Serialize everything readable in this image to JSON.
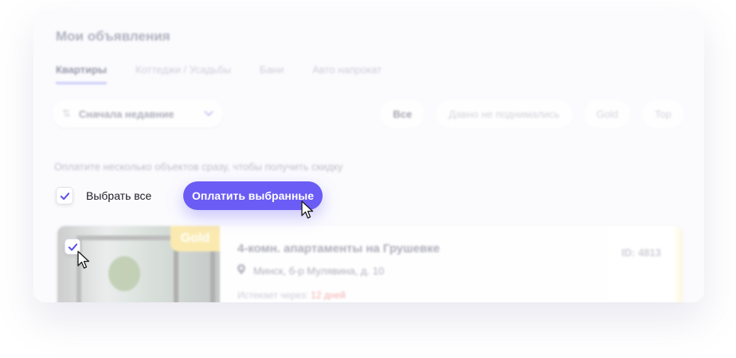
{
  "page": {
    "title": "Мои объявления"
  },
  "tabs": [
    {
      "label": "Квартиры",
      "active": true
    },
    {
      "label": "Коттеджи / Усадьбы",
      "active": false
    },
    {
      "label": "Бани",
      "active": false
    },
    {
      "label": "Авто напрокат",
      "active": false
    }
  ],
  "sort": {
    "label": "Сначала недавние",
    "icon": "sort-icon"
  },
  "filters": [
    {
      "label": "Все",
      "active": true
    },
    {
      "label": "Давно не поднимались",
      "active": false
    },
    {
      "label": "Gold",
      "active": false
    },
    {
      "label": "Top",
      "active": false
    }
  ],
  "promo": {
    "text": "Оплатите несколько объектов сразу, чтобы получить скидку"
  },
  "select_all": {
    "label": "Выбрать все",
    "checked": true
  },
  "pay_button": {
    "label": "Оплатить выбранные"
  },
  "listing": {
    "badge": "Gold",
    "title": "4-комн. апартаменты на Грушевке",
    "id_label": "ID: 4813",
    "address": "Минск, б-р Мулявина, д. 10",
    "expires_label": "Истекает через:",
    "expires_value": "12 дней",
    "checked": true
  },
  "colors": {
    "accent": "#6b5cf5",
    "check": "#5b4fe8",
    "gold": "#fbe9a8",
    "expires": "#f4a7a7"
  }
}
